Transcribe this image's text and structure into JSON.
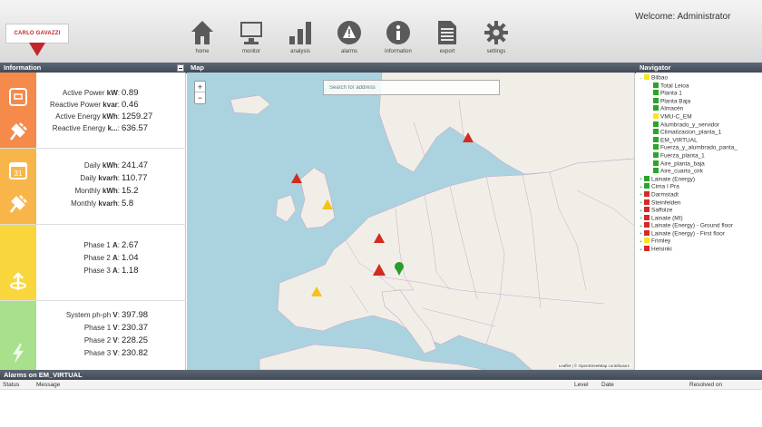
{
  "header": {
    "logo_text": "CARLO GAVAZZI",
    "welcome": "Welcome: Administrator",
    "nav": [
      {
        "label": "home",
        "icon": "home-icon"
      },
      {
        "label": "monitor",
        "icon": "monitor-icon"
      },
      {
        "label": "analysis",
        "icon": "bar-chart-icon"
      },
      {
        "label": "alarms",
        "icon": "alarm-warning-icon"
      },
      {
        "label": "information",
        "icon": "info-icon"
      },
      {
        "label": "export",
        "icon": "document-icon"
      },
      {
        "label": "settings",
        "icon": "gear-icon"
      }
    ]
  },
  "information": {
    "title": "Information",
    "sections": [
      {
        "color": "#f58a4b",
        "rows": [
          {
            "label": "Active Power ",
            "unit": "kW",
            "value": "0.89"
          },
          {
            "label": "Reactive Power ",
            "unit": "kvar",
            "value": "0.46"
          },
          {
            "label": "Active Energy ",
            "unit": "kWh",
            "value": "1259.27"
          },
          {
            "label": "Reactive Energy ",
            "unit": "k...",
            "value": "636.57"
          }
        ]
      },
      {
        "color": "#f8b64a",
        "rows": [
          {
            "label": "Daily ",
            "unit": "kWh",
            "value": "241.47"
          },
          {
            "label": "Daily ",
            "unit": "kvarh",
            "value": "110.77"
          },
          {
            "label": "Monthly ",
            "unit": "kWh",
            "value": "15.2"
          },
          {
            "label": "Monthly ",
            "unit": "kvarh",
            "value": "5.8"
          }
        ]
      },
      {
        "color": "#f9d63c",
        "rows": [
          {
            "label": "Phase 1 ",
            "unit": "A",
            "value": "2.67"
          },
          {
            "label": "Phase 2 ",
            "unit": "A",
            "value": "1.04"
          },
          {
            "label": "Phase 3 ",
            "unit": "A",
            "value": "1.18"
          }
        ]
      },
      {
        "color": "#a8e08c",
        "rows": [
          {
            "label": "System ph-ph ",
            "unit": "V",
            "value": "397.98"
          },
          {
            "label": "Phase 1 ",
            "unit": "V",
            "value": "230.37"
          },
          {
            "label": "Phase 2 ",
            "unit": "V",
            "value": "228.25"
          },
          {
            "label": "Phase 3 ",
            "unit": "V",
            "value": "230.82"
          }
        ]
      }
    ]
  },
  "map": {
    "title": "Map",
    "search_placeholder": "Search for address",
    "zoom_in": "+",
    "zoom_out": "−",
    "attribution": "Leaflet | © OpenStreetMap contributors"
  },
  "navigator": {
    "title": "Navigator",
    "items": [
      {
        "label": "Bilbao",
        "color": "#f6e61f",
        "level": 0,
        "expander": "−"
      },
      {
        "label": "Total Leioa",
        "color": "#2aa52a",
        "level": 1,
        "expander": ""
      },
      {
        "label": "Planta 1",
        "color": "#2aa52a",
        "level": 1,
        "expander": ""
      },
      {
        "label": "Planta Baja",
        "color": "#2aa52a",
        "level": 1,
        "expander": ""
      },
      {
        "label": "Almacén",
        "color": "#2aa52a",
        "level": 1,
        "expander": ""
      },
      {
        "label": "VMU-C_EM",
        "color": "#f6e61f",
        "level": 1,
        "expander": ""
      },
      {
        "label": "Alumbrado_y_servidor",
        "color": "#2aa52a",
        "level": 1,
        "expander": ""
      },
      {
        "label": "Climatizacion_planta_1",
        "color": "#2aa52a",
        "level": 1,
        "expander": ""
      },
      {
        "label": "EM_VIRTUAL",
        "color": "#2aa52a",
        "level": 1,
        "expander": ""
      },
      {
        "label": "Fuerza_y_alumbrado_panta_",
        "color": "#2aa52a",
        "level": 1,
        "expander": ""
      },
      {
        "label": "Fuerza_planta_1",
        "color": "#2aa52a",
        "level": 1,
        "expander": ""
      },
      {
        "label": "Aire_planta_baja",
        "color": "#2aa52a",
        "level": 1,
        "expander": ""
      },
      {
        "label": "Aire_cuarto_cirk",
        "color": "#2aa52a",
        "level": 1,
        "expander": ""
      },
      {
        "label": "Lainate (Energy)",
        "color": "#2aa52a",
        "level": 0,
        "expander": "+"
      },
      {
        "label": "Cima I Pra",
        "color": "#2aa52a",
        "level": 0,
        "expander": "+"
      },
      {
        "label": "Darmstadt",
        "color": "#d42a2a",
        "level": 0,
        "expander": "+"
      },
      {
        "label": "Steinfelden",
        "color": "#d42a2a",
        "level": 0,
        "expander": "+"
      },
      {
        "label": "Saffolze",
        "color": "#d42a2a",
        "level": 0,
        "expander": "+"
      },
      {
        "label": "Lainate (MI)",
        "color": "#d42a2a",
        "level": 0,
        "expander": "+"
      },
      {
        "label": "Lainate (Energy) - Ground floor",
        "color": "#d42a2a",
        "level": 0,
        "expander": "+"
      },
      {
        "label": "Lainate (Energy) - First floor",
        "color": "#d42a2a",
        "level": 0,
        "expander": "+"
      },
      {
        "label": "Frimley",
        "color": "#f6e61f",
        "level": 0,
        "expander": "+"
      },
      {
        "label": "Helsinki",
        "color": "#d42a2a",
        "level": 0,
        "expander": "+"
      }
    ]
  },
  "alarms": {
    "title": "Alarms on EM_VIRTUAL",
    "columns": [
      {
        "label": "Status"
      },
      {
        "label": "Message"
      },
      {
        "label": "Level"
      },
      {
        "label": "Date"
      },
      {
        "label": "Resolved on"
      }
    ]
  }
}
